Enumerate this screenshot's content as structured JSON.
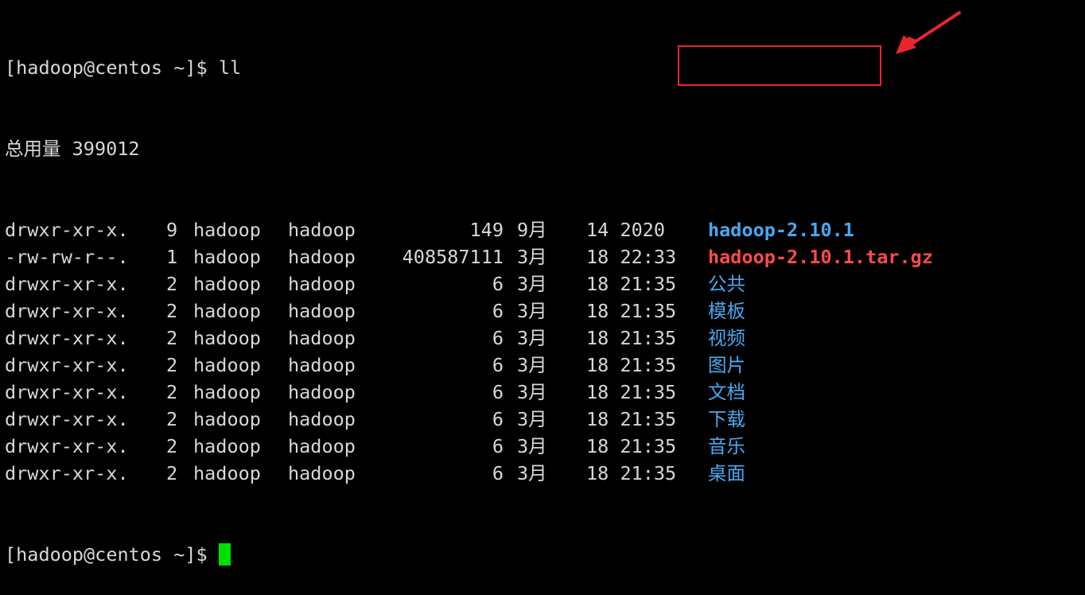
{
  "terminal": {
    "prompt": "[hadoop@centos ~]$",
    "command": "ll",
    "total_line": "总用量 399012",
    "entries": [
      {
        "perm": "drwxr-xr-x.",
        "links": "9",
        "owner": "hadoop",
        "group": "hadoop",
        "size": "149",
        "month": "9月",
        "time": "14 2020",
        "name": "hadoop-2.10.1",
        "kind": "dir"
      },
      {
        "perm": "-rw-rw-r--.",
        "links": "1",
        "owner": "hadoop",
        "group": "hadoop",
        "size": "408587111",
        "month": "3月",
        "time": "18 22:33",
        "name": "hadoop-2.10.1.tar.gz",
        "kind": "archive"
      },
      {
        "perm": "drwxr-xr-x.",
        "links": "2",
        "owner": "hadoop",
        "group": "hadoop",
        "size": "6",
        "month": "3月",
        "time": "18 21:35",
        "name": "公共",
        "kind": "dir"
      },
      {
        "perm": "drwxr-xr-x.",
        "links": "2",
        "owner": "hadoop",
        "group": "hadoop",
        "size": "6",
        "month": "3月",
        "time": "18 21:35",
        "name": "模板",
        "kind": "dir"
      },
      {
        "perm": "drwxr-xr-x.",
        "links": "2",
        "owner": "hadoop",
        "group": "hadoop",
        "size": "6",
        "month": "3月",
        "time": "18 21:35",
        "name": "视频",
        "kind": "dir"
      },
      {
        "perm": "drwxr-xr-x.",
        "links": "2",
        "owner": "hadoop",
        "group": "hadoop",
        "size": "6",
        "month": "3月",
        "time": "18 21:35",
        "name": "图片",
        "kind": "dir"
      },
      {
        "perm": "drwxr-xr-x.",
        "links": "2",
        "owner": "hadoop",
        "group": "hadoop",
        "size": "6",
        "month": "3月",
        "time": "18 21:35",
        "name": "文档",
        "kind": "dir"
      },
      {
        "perm": "drwxr-xr-x.",
        "links": "2",
        "owner": "hadoop",
        "group": "hadoop",
        "size": "6",
        "month": "3月",
        "time": "18 21:35",
        "name": "下载",
        "kind": "dir"
      },
      {
        "perm": "drwxr-xr-x.",
        "links": "2",
        "owner": "hadoop",
        "group": "hadoop",
        "size": "6",
        "month": "3月",
        "time": "18 21:35",
        "name": "音乐",
        "kind": "dir"
      },
      {
        "perm": "drwxr-xr-x.",
        "links": "2",
        "owner": "hadoop",
        "group": "hadoop",
        "size": "6",
        "month": "3月",
        "time": "18 21:35",
        "name": "桌面",
        "kind": "dir"
      }
    ],
    "final_prompt": "[hadoop@centos ~]$"
  },
  "colors": {
    "background": "#000000",
    "text": "#d8d8d8",
    "directory": "#4aa8f0",
    "archive": "#ff4a4a",
    "cursor": "#00e000",
    "annotation": "#e8262d"
  },
  "annotations": {
    "highlight_box_target": "hadoop-2.10.1",
    "arrow_icon": "arrow-pointer-icon"
  }
}
